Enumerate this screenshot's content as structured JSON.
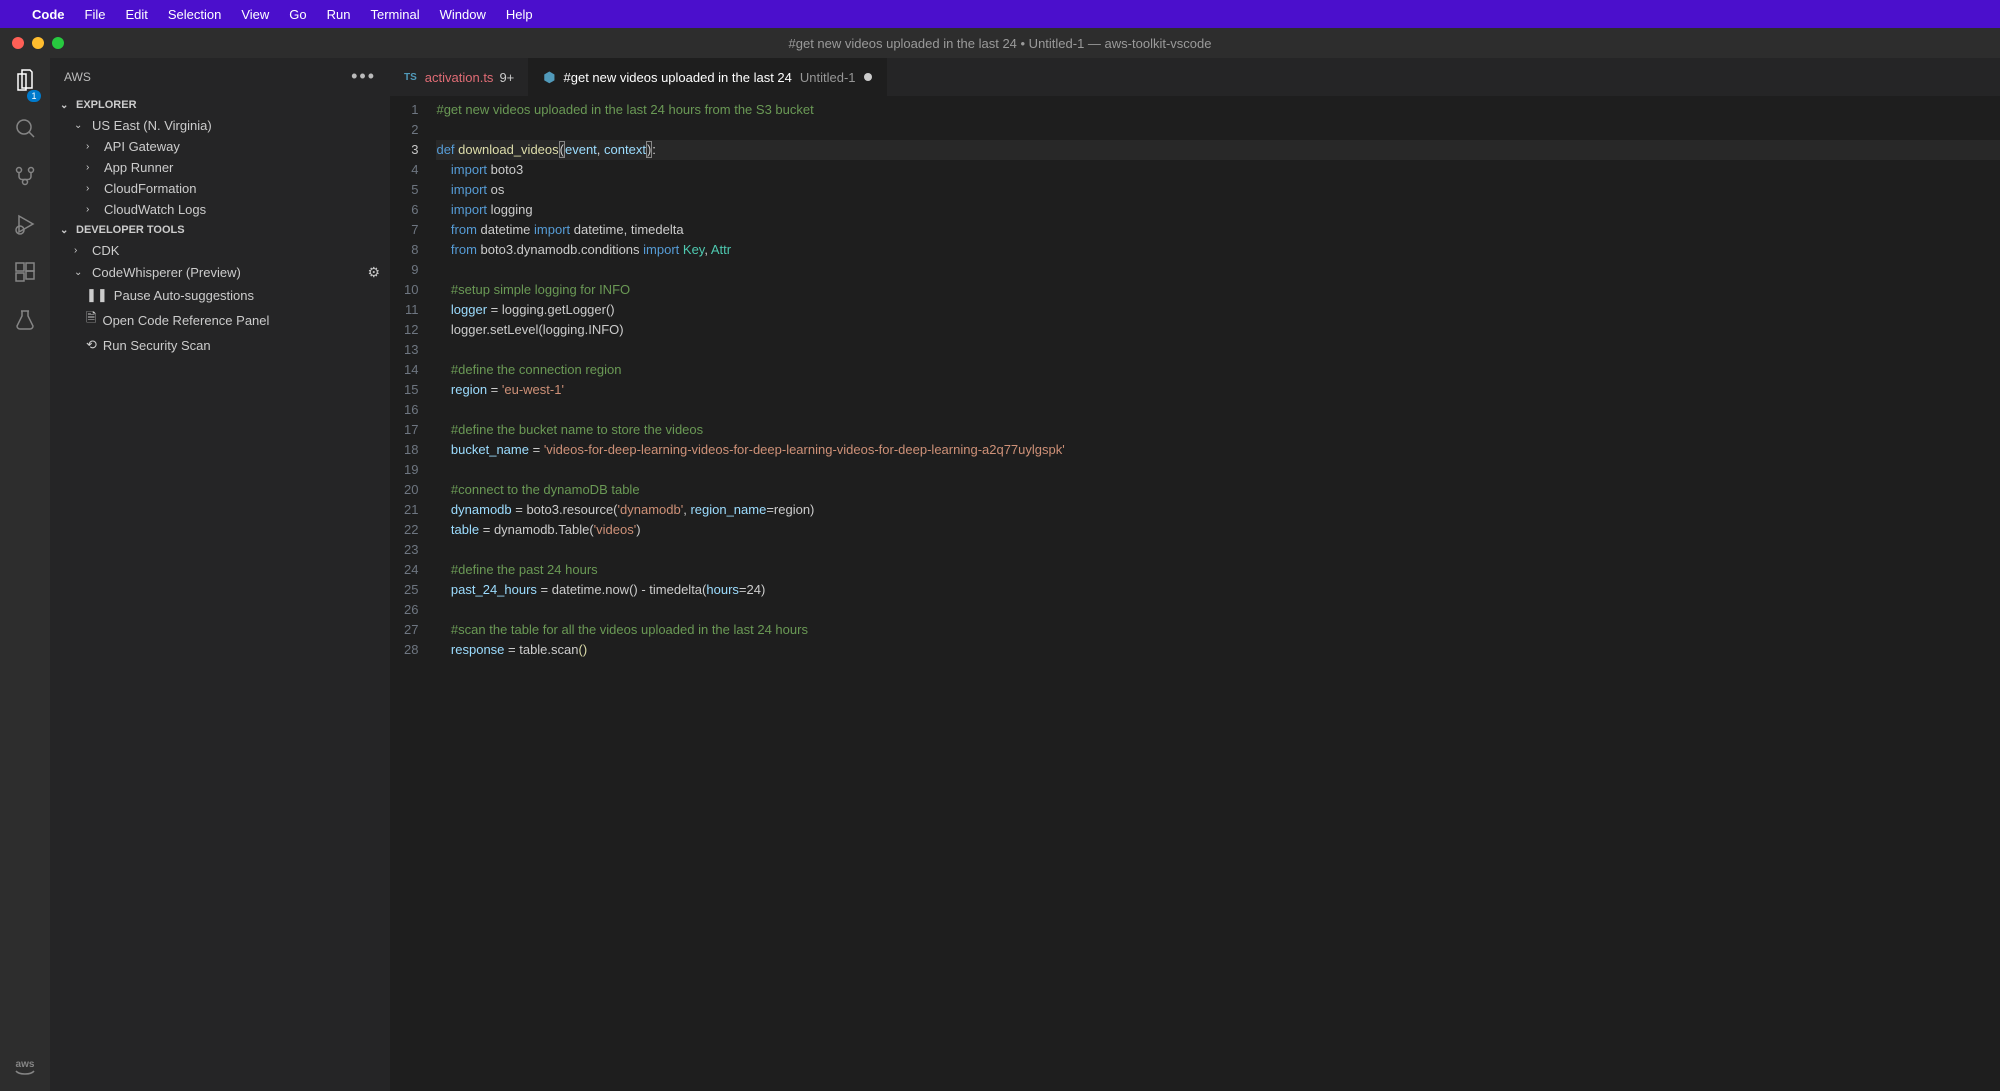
{
  "menubar": {
    "app": "Code",
    "items": [
      "File",
      "Edit",
      "Selection",
      "View",
      "Go",
      "Run",
      "Terminal",
      "Window",
      "Help"
    ]
  },
  "window": {
    "title": "#get new videos uploaded in the last 24 • Untitled-1 — aws-toolkit-vscode"
  },
  "activitybar": {
    "badge": "1",
    "aws_label": "aws"
  },
  "sidebar": {
    "title": "AWS",
    "explorer": {
      "label": "EXPLORER",
      "region": "US East (N. Virginia)",
      "items": [
        "API Gateway",
        "App Runner",
        "CloudFormation",
        "CloudWatch Logs"
      ]
    },
    "devtools": {
      "label": "DEVELOPER TOOLS",
      "cdk": "CDK",
      "cw": "CodeWhisperer (Preview)",
      "actions": [
        "Pause Auto-suggestions",
        "Open Code Reference Panel",
        "Run Security Scan"
      ]
    }
  },
  "tabs": [
    {
      "icon": "TS",
      "name": "activation.ts",
      "mod": "9+",
      "kind": "ts"
    },
    {
      "icon": "⬡",
      "name": "#get new videos uploaded in the last 24",
      "sub": "Untitled-1",
      "active": true,
      "dirty": true,
      "kind": "py"
    }
  ],
  "editor": {
    "active_line": 3,
    "lines": [
      [
        {
          "c": "c-comment",
          "t": "#get new videos uploaded in the last 24 hours from the S3 bucket"
        }
      ],
      [],
      [
        {
          "c": "c-kw",
          "t": "def"
        },
        {
          "c": "",
          "t": " "
        },
        {
          "c": "c-fn",
          "t": "download_videos"
        },
        {
          "c": "c-paren-hl",
          "t": "("
        },
        {
          "c": "c-var",
          "t": "event"
        },
        {
          "c": "c-op",
          "t": ", "
        },
        {
          "c": "c-var",
          "t": "context"
        },
        {
          "c": "c-paren-hl",
          "t": ")"
        },
        {
          "c": "c-op",
          "t": ":"
        }
      ],
      [
        {
          "c": "",
          "t": "    "
        },
        {
          "c": "c-kw",
          "t": "import"
        },
        {
          "c": "",
          "t": " boto3"
        }
      ],
      [
        {
          "c": "",
          "t": "    "
        },
        {
          "c": "c-kw",
          "t": "import"
        },
        {
          "c": "",
          "t": " os"
        }
      ],
      [
        {
          "c": "",
          "t": "    "
        },
        {
          "c": "c-kw",
          "t": "import"
        },
        {
          "c": "",
          "t": " logging"
        }
      ],
      [
        {
          "c": "",
          "t": "    "
        },
        {
          "c": "c-kw",
          "t": "from"
        },
        {
          "c": "",
          "t": " datetime "
        },
        {
          "c": "c-kw",
          "t": "import"
        },
        {
          "c": "",
          "t": " datetime, timedelta"
        }
      ],
      [
        {
          "c": "",
          "t": "    "
        },
        {
          "c": "c-kw",
          "t": "from"
        },
        {
          "c": "",
          "t": " boto3.dynamodb.conditions "
        },
        {
          "c": "c-kw",
          "t": "import"
        },
        {
          "c": "",
          "t": " "
        },
        {
          "c": "c-type",
          "t": "Key"
        },
        {
          "c": "",
          "t": ", "
        },
        {
          "c": "c-type",
          "t": "Attr"
        }
      ],
      [],
      [
        {
          "c": "",
          "t": "    "
        },
        {
          "c": "c-comment",
          "t": "#setup simple logging for INFO"
        }
      ],
      [
        {
          "c": "",
          "t": "    "
        },
        {
          "c": "c-var",
          "t": "logger"
        },
        {
          "c": "",
          "t": " = logging.getLogger()"
        }
      ],
      [
        {
          "c": "",
          "t": "    logger.setLevel(logging.INFO)"
        }
      ],
      [],
      [
        {
          "c": "",
          "t": "    "
        },
        {
          "c": "c-comment",
          "t": "#define the connection region"
        }
      ],
      [
        {
          "c": "",
          "t": "    "
        },
        {
          "c": "c-var",
          "t": "region"
        },
        {
          "c": "",
          "t": " = "
        },
        {
          "c": "c-str",
          "t": "'eu-west-1'"
        }
      ],
      [],
      [
        {
          "c": "",
          "t": "    "
        },
        {
          "c": "c-comment",
          "t": "#define the bucket name to store the videos"
        }
      ],
      [
        {
          "c": "",
          "t": "    "
        },
        {
          "c": "c-var",
          "t": "bucket_name"
        },
        {
          "c": "",
          "t": " = "
        },
        {
          "c": "c-str",
          "t": "'videos-for-deep-learning-videos-for-deep-learning-videos-for-deep-learning-a2q77uylgspk'"
        }
      ],
      [],
      [
        {
          "c": "",
          "t": "    "
        },
        {
          "c": "c-comment",
          "t": "#connect to the dynamoDB table"
        }
      ],
      [
        {
          "c": "",
          "t": "    "
        },
        {
          "c": "c-var",
          "t": "dynamodb"
        },
        {
          "c": "",
          "t": " = boto3.resource("
        },
        {
          "c": "c-str",
          "t": "'dynamodb'"
        },
        {
          "c": "",
          "t": ", "
        },
        {
          "c": "c-var",
          "t": "region_name"
        },
        {
          "c": "",
          "t": "=region)"
        }
      ],
      [
        {
          "c": "",
          "t": "    "
        },
        {
          "c": "c-var",
          "t": "table"
        },
        {
          "c": "",
          "t": " = dynamodb.Table("
        },
        {
          "c": "c-str",
          "t": "'videos'"
        },
        {
          "c": "",
          "t": ")"
        }
      ],
      [],
      [
        {
          "c": "",
          "t": "    "
        },
        {
          "c": "c-comment",
          "t": "#define the past 24 hours"
        }
      ],
      [
        {
          "c": "",
          "t": "    "
        },
        {
          "c": "c-var",
          "t": "past_24_hours"
        },
        {
          "c": "",
          "t": " = datetime.now() - timedelta("
        },
        {
          "c": "c-var",
          "t": "hours"
        },
        {
          "c": "",
          "t": "="
        },
        {
          "c": "",
          "t": "24)"
        }
      ],
      [],
      [
        {
          "c": "",
          "t": "    "
        },
        {
          "c": "c-comment",
          "t": "#scan the table for all the videos uploaded in the last 24 hours"
        }
      ],
      [
        {
          "c": "",
          "t": "    "
        },
        {
          "c": "c-var",
          "t": "response"
        },
        {
          "c": "",
          "t": " = table.scan"
        },
        {
          "c": "c-fn",
          "t": "()"
        }
      ]
    ]
  }
}
